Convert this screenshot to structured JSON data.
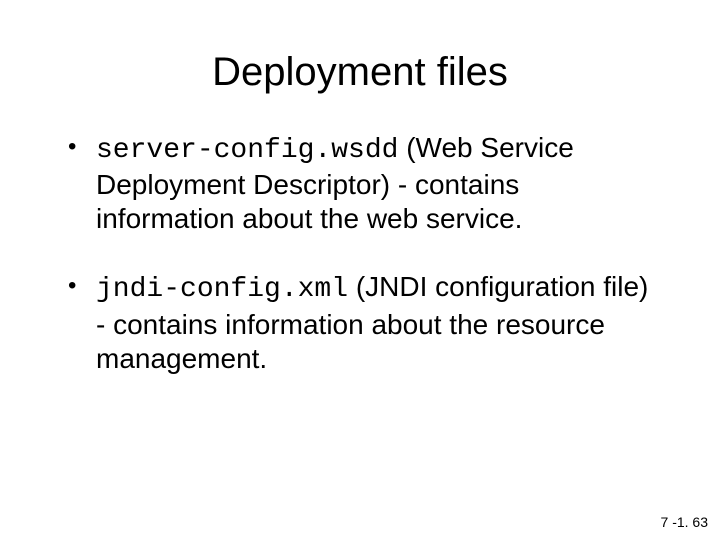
{
  "title": "Deployment files",
  "bullets": [
    {
      "code": "server-config.wsdd",
      "rest": " (Web Service Deployment Descriptor) - contains information about the web service."
    },
    {
      "code": "jndi-config.xml",
      "rest": " (JNDI configuration file) - contains information about the resource management."
    }
  ],
  "page_number": "7 -1. 63"
}
